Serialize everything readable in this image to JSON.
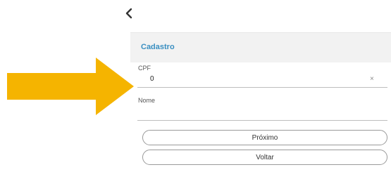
{
  "nav": {
    "back_icon": "chevron-left-icon"
  },
  "pointer": {
    "icon": "arrow-right-icon",
    "color": "#f5b400"
  },
  "form": {
    "title": "Cadastro",
    "cpf": {
      "label": "CPF",
      "value": "0",
      "clear_glyph": "×"
    },
    "nome": {
      "label": "Nome",
      "value": ""
    },
    "buttons": {
      "next_label": "Próximo",
      "back_label": "Voltar"
    }
  },
  "colors": {
    "title": "#3a8fc1",
    "header_bg": "#f2f2f2"
  }
}
